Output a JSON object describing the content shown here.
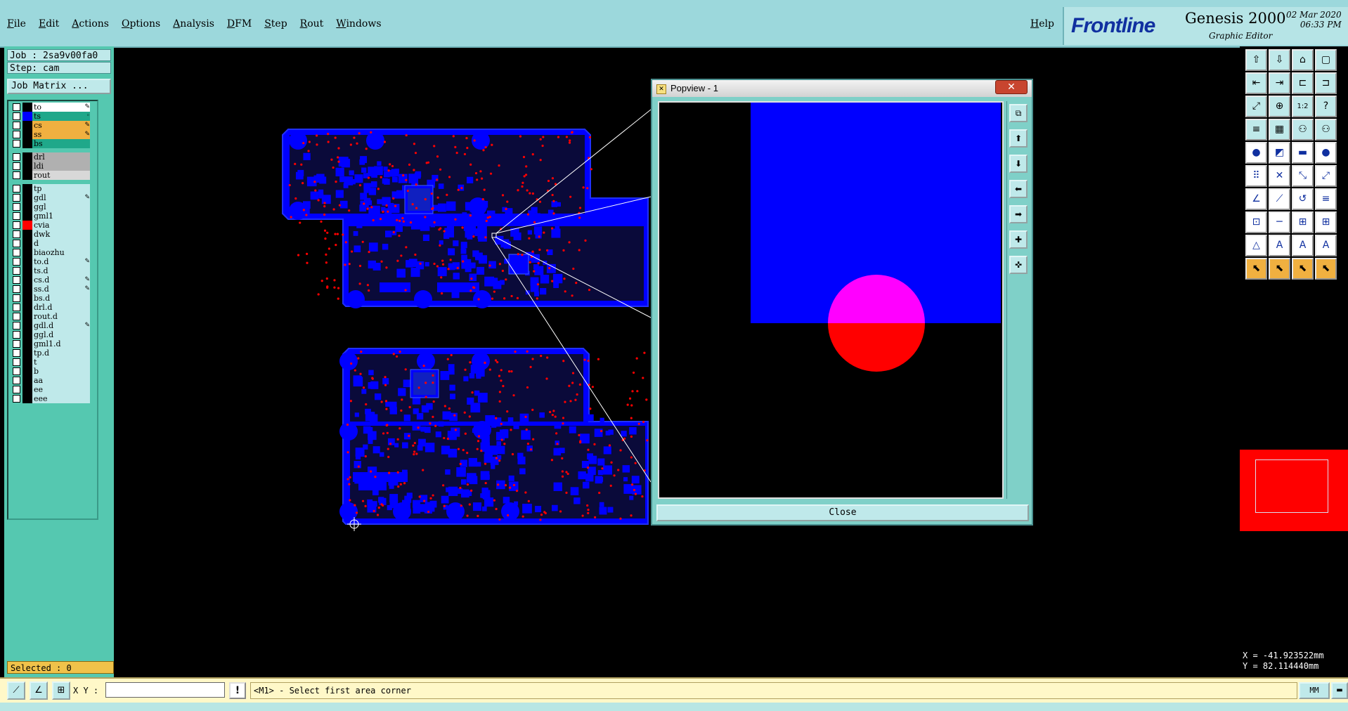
{
  "menubar": {
    "items": [
      "File",
      "Edit",
      "Actions",
      "Options",
      "Analysis",
      "DFM",
      "Step",
      "Rout",
      "Windows"
    ],
    "help": "Help"
  },
  "brand": {
    "logo": "Frontline",
    "product": "Genesis 2000",
    "subtitle": "Graphic Editor",
    "date": "02 Mar 2020",
    "time": "06:33 PM"
  },
  "job": {
    "job_line": "Job : 2sa9v00fa0",
    "step_line": "Step: cam",
    "matrix_button": "Job Matrix ..."
  },
  "layers": [
    {
      "name": "to",
      "color": "#ffffff",
      "swatch": "#000000",
      "mark": "✎",
      "group": 0
    },
    {
      "name": "ts",
      "color": "#1fa88a",
      "swatch": "#0000ff",
      "mark": "◦",
      "group": 0
    },
    {
      "name": "cs",
      "color": "#f0b040",
      "swatch": "#000000",
      "mark": "✎",
      "group": 0
    },
    {
      "name": "ss",
      "color": "#f0b040",
      "swatch": "#000000",
      "mark": "✎",
      "group": 0
    },
    {
      "name": "bs",
      "color": "#1fa88a",
      "swatch": "#000000",
      "mark": "",
      "group": 0
    },
    {
      "name": "drl",
      "color": "#b0b0b0",
      "swatch": "#000000",
      "mark": "",
      "group": 1
    },
    {
      "name": "ldi",
      "color": "#b0b0b0",
      "swatch": "#000000",
      "mark": "",
      "group": 1
    },
    {
      "name": "rout",
      "color": "#d8d8d8",
      "swatch": "#000000",
      "mark": "",
      "group": 1
    },
    {
      "name": "tp",
      "color": "#bfe9ea",
      "swatch": "#000000",
      "mark": "",
      "group": 2
    },
    {
      "name": "gdl",
      "color": "#bfe9ea",
      "swatch": "#000000",
      "mark": "✎",
      "group": 2
    },
    {
      "name": "ggl",
      "color": "#bfe9ea",
      "swatch": "#000000",
      "mark": "",
      "group": 2
    },
    {
      "name": "gml1",
      "color": "#bfe9ea",
      "swatch": "#000000",
      "mark": "",
      "group": 2
    },
    {
      "name": "cvia",
      "color": "#bfe9ea",
      "swatch": "#ff0000",
      "mark": "",
      "group": 2
    },
    {
      "name": "dwk",
      "color": "#bfe9ea",
      "swatch": "#000000",
      "mark": "",
      "group": 2
    },
    {
      "name": "d",
      "color": "#bfe9ea",
      "swatch": "#000000",
      "mark": "",
      "group": 2
    },
    {
      "name": "biaozhu",
      "color": "#bfe9ea",
      "swatch": "#000000",
      "mark": "",
      "group": 2
    },
    {
      "name": "to.d",
      "color": "#bfe9ea",
      "swatch": "#000000",
      "mark": "✎",
      "group": 2
    },
    {
      "name": "ts.d",
      "color": "#bfe9ea",
      "swatch": "#000000",
      "mark": "",
      "group": 2
    },
    {
      "name": "cs.d",
      "color": "#bfe9ea",
      "swatch": "#000000",
      "mark": "✎",
      "group": 2
    },
    {
      "name": "ss.d",
      "color": "#bfe9ea",
      "swatch": "#000000",
      "mark": "✎",
      "group": 2
    },
    {
      "name": "bs.d",
      "color": "#bfe9ea",
      "swatch": "#000000",
      "mark": "",
      "group": 2
    },
    {
      "name": "drl.d",
      "color": "#bfe9ea",
      "swatch": "#000000",
      "mark": "",
      "group": 2
    },
    {
      "name": "rout.d",
      "color": "#bfe9ea",
      "swatch": "#000000",
      "mark": "",
      "group": 2
    },
    {
      "name": "gdl.d",
      "color": "#bfe9ea",
      "swatch": "#000000",
      "mark": "✎",
      "group": 2
    },
    {
      "name": "ggl.d",
      "color": "#bfe9ea",
      "swatch": "#000000",
      "mark": "",
      "group": 2
    },
    {
      "name": "gml1.d",
      "color": "#bfe9ea",
      "swatch": "#000000",
      "mark": "",
      "group": 2
    },
    {
      "name": "tp.d",
      "color": "#bfe9ea",
      "swatch": "#000000",
      "mark": "",
      "group": 2
    },
    {
      "name": "t",
      "color": "#bfe9ea",
      "swatch": "#000000",
      "mark": "",
      "group": 2
    },
    {
      "name": "b",
      "color": "#bfe9ea",
      "swatch": "#000000",
      "mark": "",
      "group": 2
    },
    {
      "name": "aa",
      "color": "#bfe9ea",
      "swatch": "#000000",
      "mark": "",
      "group": 2
    },
    {
      "name": "ee",
      "color": "#bfe9ea",
      "swatch": "#000000",
      "mark": "",
      "group": 2
    },
    {
      "name": "eee",
      "color": "#bfe9ea",
      "swatch": "#000000",
      "mark": "",
      "group": 2
    }
  ],
  "selected": "Selected : 0",
  "popview": {
    "title": "Popview - 1",
    "close_label": "Close"
  },
  "coords": {
    "x": "X = -41.923522mm",
    "y": "Y = 82.114440mm"
  },
  "bottombar": {
    "xy_label": "X Y :",
    "xy_value": "",
    "warn": "!",
    "status": "<M1> - Select first area corner",
    "units": "MM"
  },
  "colors": {
    "board": "#0000ff",
    "via": "#ff0000",
    "highlight": "#ff00ff",
    "panel": "#55c8b0",
    "menubar": "#9cd8dc"
  }
}
